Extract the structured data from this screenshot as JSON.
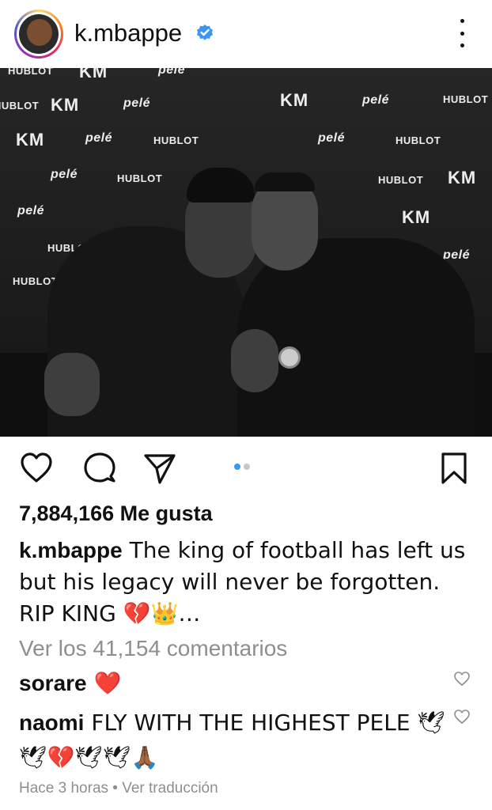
{
  "header": {
    "username": "k.mbappe",
    "verified_icon": "verified-badge-icon",
    "more_icon": "more-vertical-icon"
  },
  "photo": {
    "logos": [
      "HUBLOT",
      "KM",
      "pelé"
    ]
  },
  "actions": {
    "like_icon": "heart-icon",
    "comment_icon": "comment-icon",
    "share_icon": "send-icon",
    "save_icon": "bookmark-icon",
    "carousel_count": 2,
    "carousel_active": 0
  },
  "post": {
    "likes": "7,884,166 Me gusta",
    "caption_user": "k.mbappe",
    "caption_text": " The king of football has left us but his legacy will never be forgotten. RIP KING 💔👑…",
    "view_comments": "Ver los 41,154 comentarios"
  },
  "comments": [
    {
      "user": "sorare",
      "text": " ❤️"
    },
    {
      "user": "naomi",
      "text": " FLY WITH THE HIGHEST PELE 🕊🕊💔🕊🕊🙏🏾"
    }
  ],
  "meta": {
    "time": "Hace 3 horas",
    "separator": " • ",
    "translate": "Ver traducción"
  },
  "colors": {
    "accent": "#3897f0",
    "muted": "#8e8e8e",
    "text": "#111111"
  }
}
